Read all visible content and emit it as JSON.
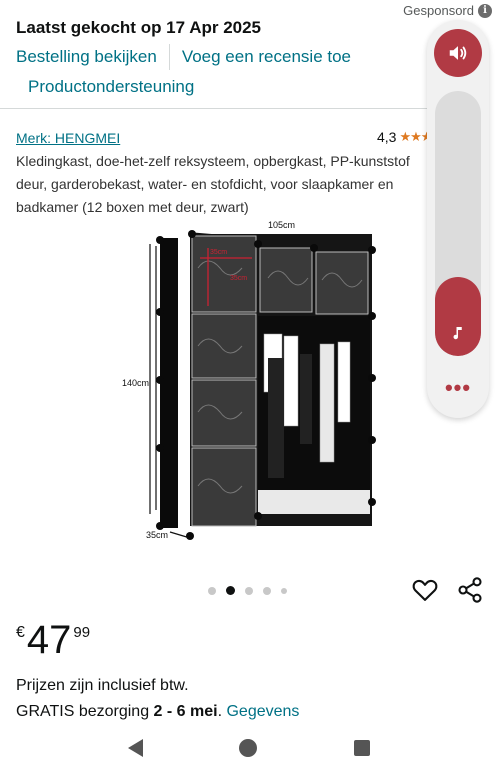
{
  "sponsored": {
    "label": "Gesponsord",
    "info_icon": "i"
  },
  "order": {
    "title": "Laatst gekocht op 17 Apr 2025",
    "links": [
      "Bestelling bekijken",
      "Voeg een recensie toe",
      "Productondersteuning"
    ]
  },
  "product": {
    "brand": "Merk: HENGMEI",
    "rating": "4,3",
    "stars_glyph": "★★★",
    "description": "Kledingkast, doe-het-zelf reksysteem, opbergkast, PP-kunststof deur, garderobekast, water- en stofdicht, voor slaapkamer en badkamer (12 boxen met deur, zwart)",
    "image_labels": {
      "width": "105cm",
      "height": "140cm",
      "depth": "35cm",
      "cube_w": "35cm",
      "cube_h": "35cm"
    }
  },
  "carousel": {
    "count": 5,
    "active_index": 1
  },
  "icons": {
    "heart": "heart-icon",
    "share": "share-icon",
    "volume": "volume-icon",
    "music": "music-note-icon"
  },
  "price": {
    "currency": "€",
    "whole": "47",
    "fraction": "99"
  },
  "tax_note": "Prijzen zijn inclusief btw.",
  "delivery": {
    "prefix": "GRATIS bezorging",
    "dates": "2 - 6 mei",
    "sep": ".",
    "details_link": "Gegevens"
  },
  "media_panel": {
    "volume_level": 0.3,
    "more_label": "•••"
  },
  "colors": {
    "link": "#007185",
    "star": "#de7921",
    "accent": "#b13a44"
  }
}
